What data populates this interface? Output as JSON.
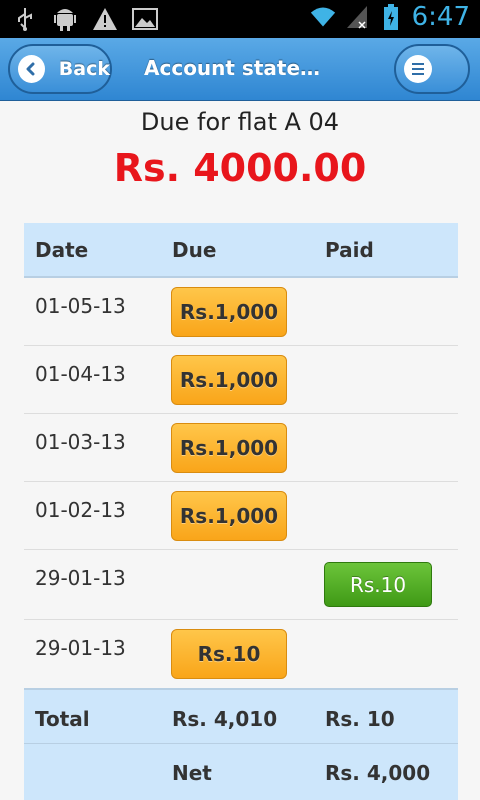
{
  "status_bar": {
    "time": "6:47",
    "left_icons": [
      "usb-icon",
      "android-icon",
      "warning-icon",
      "image-icon"
    ],
    "right_icons": [
      "wifi-icon",
      "signal-icon",
      "battery-icon"
    ]
  },
  "header": {
    "back_label": "Back",
    "title": "Account statem…",
    "menu_icon": "menu-icon"
  },
  "summary": {
    "title": "Due for flat A 04",
    "amount": "Rs. 4000.00"
  },
  "table": {
    "columns": [
      "Date",
      "Due",
      "Paid"
    ],
    "rows": [
      {
        "date": "01-05-13",
        "due": "Rs.1,000",
        "paid": ""
      },
      {
        "date": "01-04-13",
        "due": "Rs.1,000",
        "paid": ""
      },
      {
        "date": "01-03-13",
        "due": "Rs.1,000",
        "paid": ""
      },
      {
        "date": "01-02-13",
        "due": "Rs.1,000",
        "paid": ""
      },
      {
        "date": "29-01-13",
        "due": "",
        "paid": "Rs.10"
      },
      {
        "date": "29-01-13",
        "due": "Rs.10",
        "paid": ""
      }
    ],
    "total": {
      "label": "Total",
      "due": "Rs. 4,010",
      "paid": "Rs. 10"
    },
    "net": {
      "label": "",
      "due": "Net",
      "paid": "Rs. 4,000"
    }
  },
  "colors": {
    "header": "#3a8fd8",
    "amount_red": "#e8161c",
    "due_orange": "#f9a51a",
    "paid_green": "#4fa81f",
    "table_header": "#cde6fb"
  }
}
